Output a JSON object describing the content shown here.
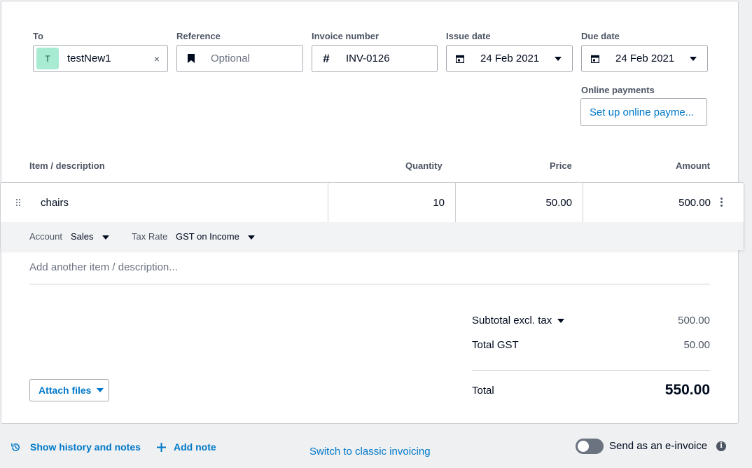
{
  "form": {
    "to": {
      "label": "To",
      "avatar_letter": "T",
      "value": "testNew1",
      "clear_glyph": "×"
    },
    "reference": {
      "label": "Reference",
      "placeholder": "Optional",
      "icon": "bookmark-icon"
    },
    "invoice_number": {
      "label": "Invoice number",
      "prefix": "#",
      "value": "INV-0126"
    },
    "issue_date": {
      "label": "Issue date",
      "value": "24 Feb 2021",
      "icon": "calendar-icon"
    },
    "due_date": {
      "label": "Due date",
      "value": "24 Feb 2021",
      "icon": "calendar-icon"
    },
    "online_payments": {
      "label": "Online payments",
      "button": "Set up online payme..."
    }
  },
  "table": {
    "headers": {
      "item": "Item / description",
      "quantity": "Quantity",
      "price": "Price",
      "amount": "Amount"
    },
    "rows": [
      {
        "description": "chairs",
        "quantity": "10",
        "price": "50.00",
        "amount": "500.00",
        "account_label": "Account",
        "account_value": "Sales",
        "tax_label": "Tax Rate",
        "tax_value": "GST on Income"
      }
    ],
    "add_placeholder": "Add another item / description..."
  },
  "totals": {
    "subtotal_label": "Subtotal excl. tax",
    "subtotal_value": "500.00",
    "gst_label": "Total GST",
    "gst_value": "50.00",
    "total_label": "Total",
    "total_value": "550.00"
  },
  "attach": {
    "label": "Attach files"
  },
  "footer": {
    "history": "Show history and notes",
    "add_note": "Add note",
    "switch_classic": "Switch to classic invoicing",
    "einvoice": "Send as an e-invoice",
    "einvoice_enabled": false
  },
  "colors": {
    "link": "#0078c8",
    "avatar_bg": "#a8ebd3",
    "text": "#000a1e",
    "muted": "#4d5563",
    "border": "#ccd0d4"
  }
}
